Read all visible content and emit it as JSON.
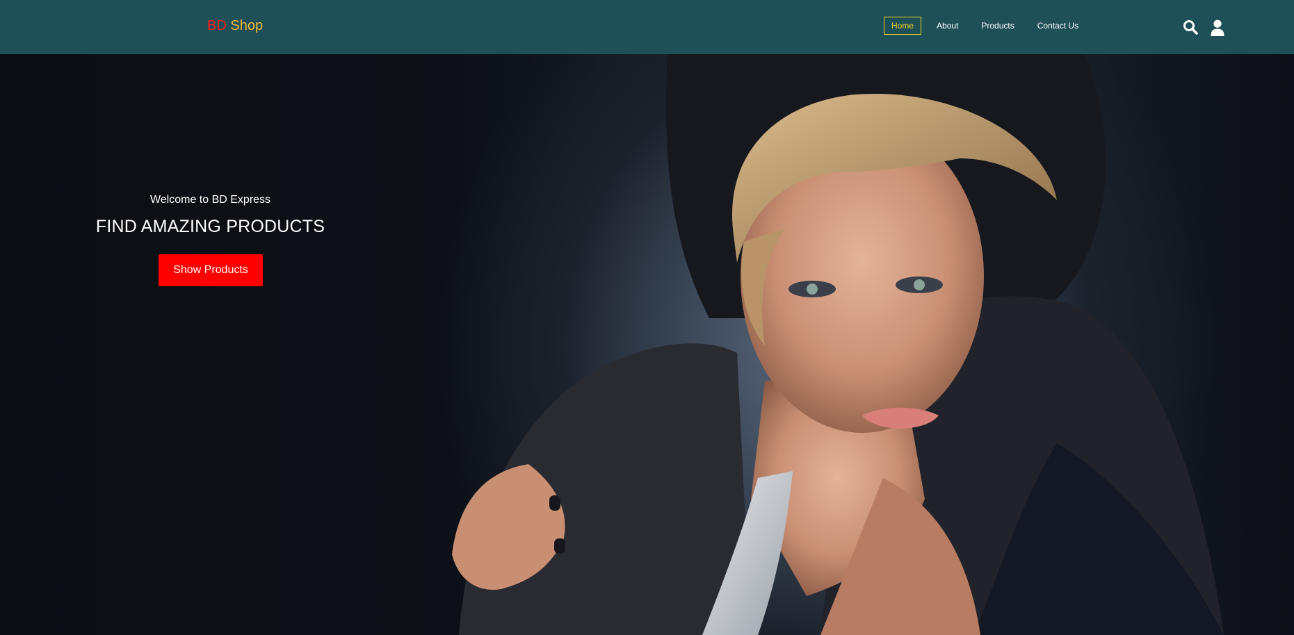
{
  "header": {
    "logo_part1": "BD",
    "logo_part2": "Shop",
    "nav": [
      "Home",
      "About",
      "Products",
      "Contact Us"
    ],
    "active_nav": "Home",
    "icons": [
      "search-icon",
      "user-icon"
    ]
  },
  "hero": {
    "welcome": "Welcome to BD Express",
    "headline": "FIND AMAZING PRODUCTS",
    "cta_label": "Show Products"
  },
  "colors": {
    "header_bg": "#1f5058",
    "logo_part1": "#ff1a1a",
    "logo_part2": "#f5b82e",
    "active_nav": "#f0d020",
    "cta_bg": "#ff0000"
  }
}
